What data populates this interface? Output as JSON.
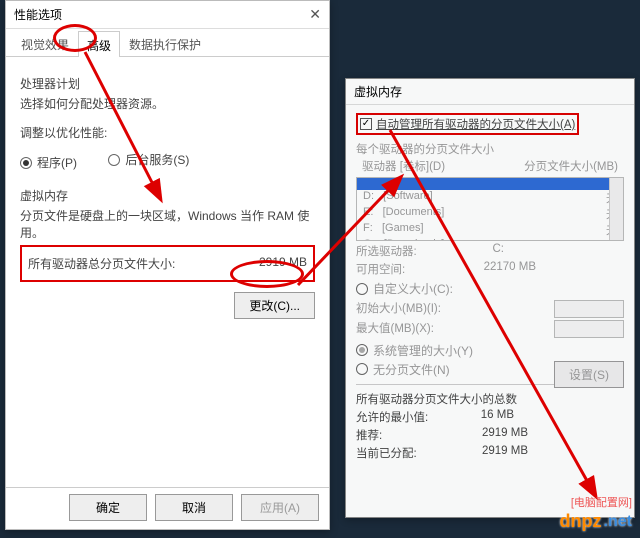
{
  "left": {
    "title": "性能选项",
    "tabs": {
      "t0": "视觉效果",
      "t1": "高级",
      "t2": "数据执行保护"
    },
    "proc_plan_title": "处理器计划",
    "proc_plan_desc": "选择如何分配处理器资源。",
    "adjust_label": "调整以优化性能:",
    "radio_programs": "程序(P)",
    "radio_services": "后台服务(S)",
    "vm_title": "虚拟内存",
    "vm_desc": "分页文件是硬盘上的一块区域，Windows 当作 RAM 使用。",
    "vm_total_label": "所有驱动器总分页文件大小:",
    "vm_total_value": "2919 MB",
    "change_btn": "更改(C)...",
    "ok": "确定",
    "cancel": "取消",
    "apply": "应用(A)"
  },
  "right": {
    "title": "虚拟内存",
    "auto_manage": "自动管理所有驱动器的分页文件大小(A)",
    "each_drive": "每个驱动器的分页文件大小",
    "col_drive": "驱动器 [卷标](D)",
    "col_size": "分页文件大小(MB)",
    "rows": [
      {
        "d": "D:",
        "l": "[Software]",
        "s": "无"
      },
      {
        "d": "E:",
        "l": "[Documents]",
        "s": "无"
      },
      {
        "d": "F:",
        "l": "[Games]",
        "s": "无"
      },
      {
        "d": "G:",
        "l": "[Downloads]",
        "s": "无"
      }
    ],
    "sel_drive_label": "所选驱动器:",
    "sel_drive_value": "C:",
    "avail_label": "可用空间:",
    "avail_value": "22170 MB",
    "custom_size": "自定义大小(C):",
    "init_size": "初始大小(MB)(I):",
    "max_size": "最大值(MB)(X):",
    "sys_managed": "系统管理的大小(Y)",
    "no_paging": "无分页文件(N)",
    "set_btn": "设置(S)",
    "totals_title": "所有驱动器分页文件大小的总数",
    "min_label": "允许的最小值:",
    "min_value": "16 MB",
    "rec_label": "推荐:",
    "rec_value": "2919 MB",
    "cur_label": "当前已分配:",
    "cur_value": "2919 MB"
  },
  "watermark": {
    "brand": "dnpz",
    "suffix": ".net",
    "sub": "[电脑配置网]"
  }
}
